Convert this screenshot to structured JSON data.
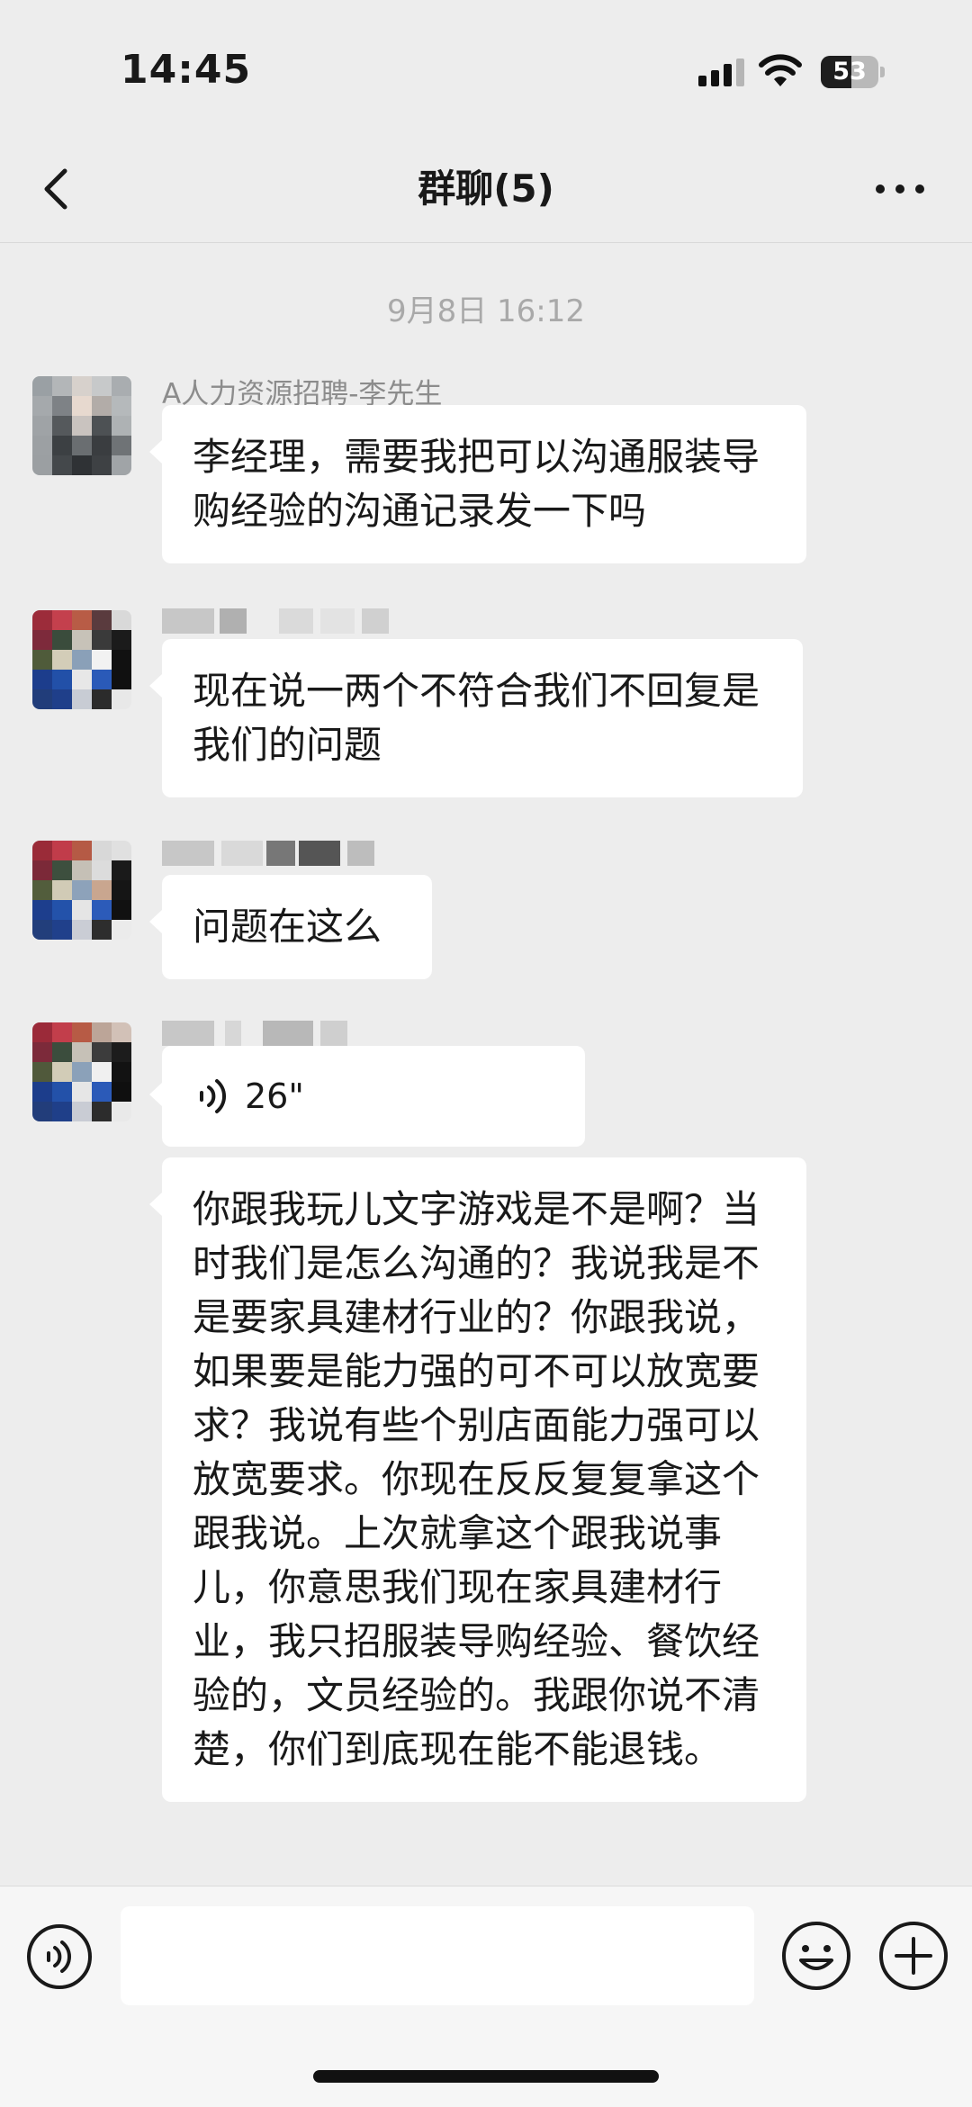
{
  "status_bar": {
    "time": "14:45",
    "battery": "53",
    "battery_level": 0.53
  },
  "header": {
    "title": "群聊(5)",
    "back_icon": "chevron-left-icon",
    "more_icon": "ellipsis-icon"
  },
  "timestamp": "9月8日 16:12",
  "messages": [
    {
      "sender": "A人力资源招聘-李先生",
      "text": "李经理，需要我把可以沟通服装导购经验的沟通记录发一下吗"
    },
    {
      "sender": "",
      "text": "现在说一两个不符合我们不回复是我们的问题"
    },
    {
      "sender": "",
      "text": "问题在这么"
    },
    {
      "sender": "",
      "voice_duration": "26\"",
      "text": "你跟我玩儿文字游戏是不是啊？当时我们是怎么沟通的？我说我是不是要家具建材行业的？你跟我说，如果要是能力强的可不可以放宽要求？我说有些个别店面能力强可以放宽要求。你现在反反复复拿这个跟我说。上次就拿这个跟我说事儿，你意思我们现在家具建材行业，我只招服装导购经验、餐饮经验的，文员经验的。我跟你说不清楚，你们到底现在能不能退钱。"
    }
  ],
  "input_bar": {
    "voice_toggle_icon": "voice-toggle-icon",
    "placeholder": "",
    "emoji_icon": "emoji-icon",
    "plus_icon": "plus-icon"
  },
  "colors": {
    "background": "#ededed",
    "bubble": "#ffffff",
    "meta_text": "#a9a9a9"
  }
}
